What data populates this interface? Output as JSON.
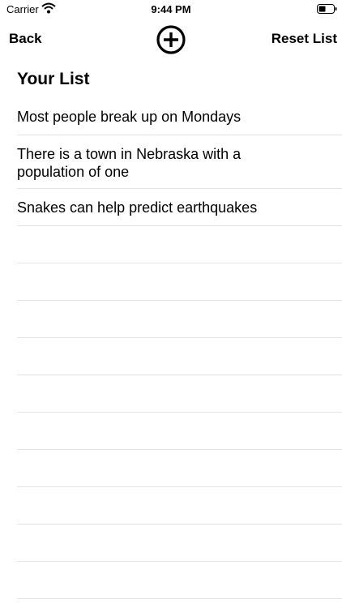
{
  "status_bar": {
    "carrier": "Carrier",
    "time": "9:44 PM",
    "battery_icon": "battery-icon",
    "wifi_icon": "wifi-icon"
  },
  "nav": {
    "back_label": "Back",
    "add_icon": "plus-circle-icon",
    "reset_label": "Reset List"
  },
  "list": {
    "title": "Your List",
    "items": [
      "Most people break up on Mondays",
      "There is a town in Nebraska with a population of one",
      "Snakes can help predict earthquakes"
    ]
  }
}
